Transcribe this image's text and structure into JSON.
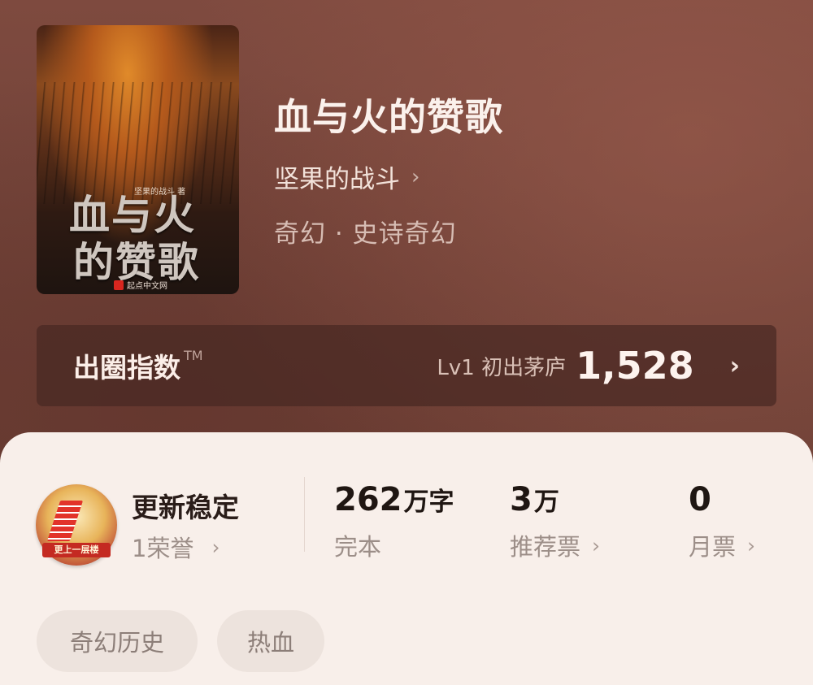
{
  "book": {
    "title": "血与火的赞歌",
    "author": "坚果的战斗",
    "author_chevron": "›",
    "genre": "奇幻 · 史诗奇幻",
    "cover": {
      "author_small": "坚果的战斗 著",
      "title_line1": "血与火",
      "title_line2": "的赞歌",
      "publisher": "起点中文网"
    }
  },
  "index_bar": {
    "label": "出圈指数",
    "tm": "TM",
    "level": "Lv1 初出茅庐",
    "score": "1,528",
    "arrow": "›"
  },
  "badge": {
    "ribbon": "更上一层楼",
    "title": "更新稳定",
    "subtitle": "1荣誉",
    "chevron": "›"
  },
  "stats": [
    {
      "number": "262",
      "unit": "万字",
      "label": "完本",
      "chevron": ""
    },
    {
      "number": "3",
      "unit": "万",
      "label": "推荐票",
      "chevron": "›"
    },
    {
      "number": "0",
      "unit": "",
      "label": "月票",
      "chevron": "›"
    }
  ],
  "tags": [
    "奇幻历史",
    "热血"
  ],
  "colors": {
    "hero_bg": "#6f4137",
    "card_bg": "#f8efea",
    "tag_bg": "#ede3dd"
  }
}
